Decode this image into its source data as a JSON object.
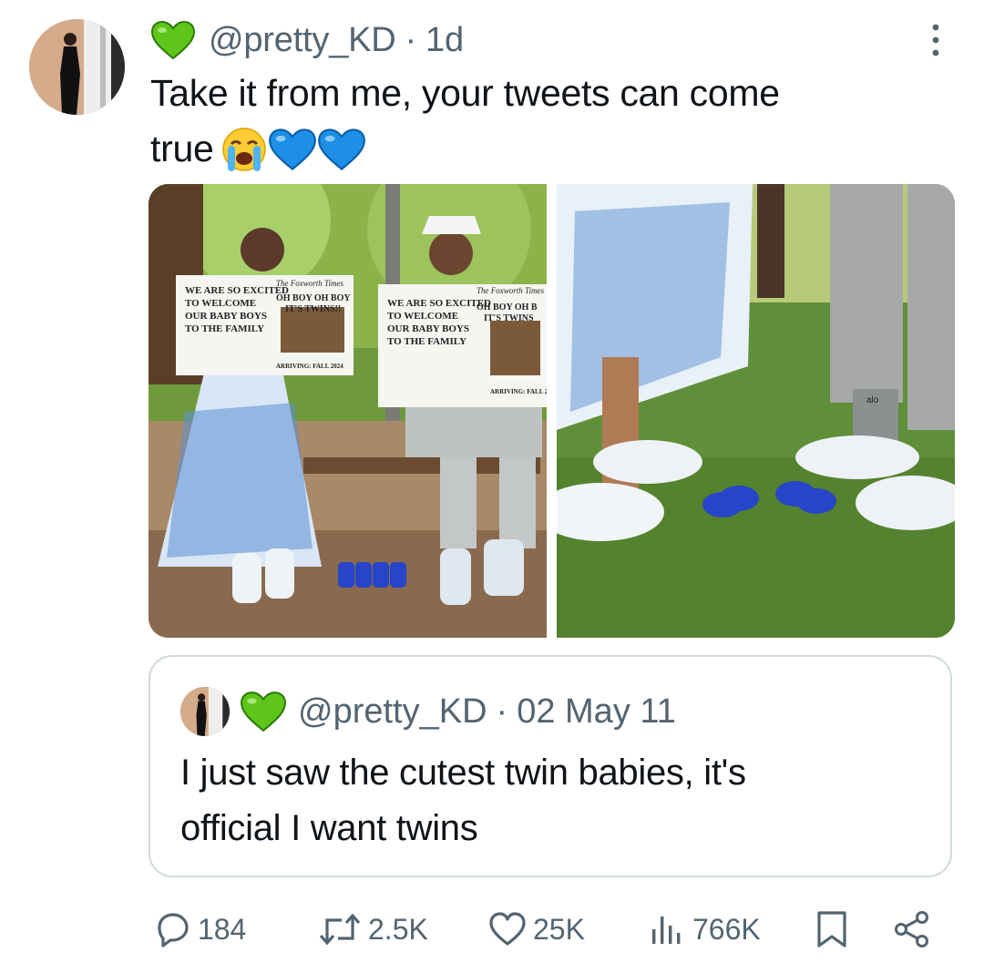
{
  "tweet": {
    "handle": "@pretty_KD",
    "separator": "·",
    "age": "1d",
    "text_line1": "Take it from me, your tweets can come",
    "text_line2": "true",
    "emojis": [
      "loudly-crying-face",
      "blue-heart",
      "blue-heart"
    ],
    "heart_color": "#5ec61b"
  },
  "media": {
    "photos": [
      {
        "name": "photo-couple-on-bench",
        "newspaper_left": {
          "headline": "WE ARE SO EXCITED TO WELCOME OUR BABY BOYS TO THE FAMILY",
          "masthead": "The Foxworth Times",
          "subhead": "OH BOY OH BOY IT'S TWINS!!",
          "footer": "ARRIVING: FALL 2024"
        },
        "newspaper_right": {
          "headline": "WE ARE SO EXCITED TO WELCOME OUR BABY BOYS TO THE FAMILY",
          "masthead": "The Foxworth Times",
          "subhead": "OH BOY OH B IT'S TWINS",
          "footer": "ARRIVING: FALL 202"
        }
      },
      {
        "name": "photo-feet-and-baby-shoes",
        "sock_brand": "alo"
      }
    ]
  },
  "quote": {
    "handle": "@pretty_KD",
    "separator": "·",
    "date": "02 May 11",
    "text_line1": "I just saw the cutest twin babies, it's",
    "text_line2": "official I want twins"
  },
  "actions": {
    "replies": "184",
    "reposts": "2.5K",
    "likes": "25K",
    "views": "766K"
  },
  "colors": {
    "secondary_text": "#536471",
    "border": "#cfd9de",
    "heart_green": "#5ec61b",
    "blue_heart": "#1d8fe6"
  }
}
